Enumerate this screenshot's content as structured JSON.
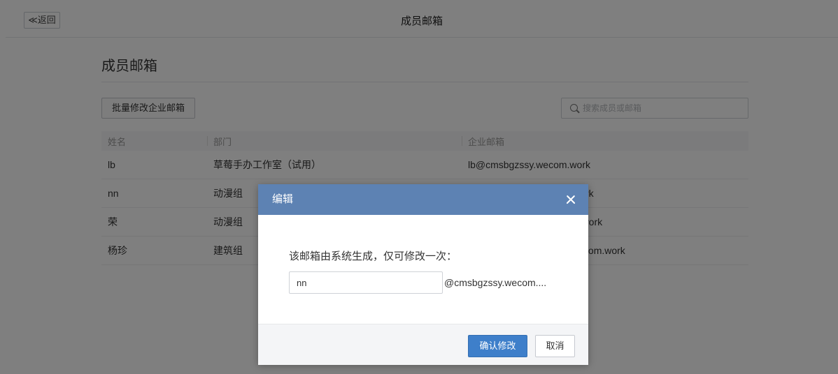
{
  "topbar": {
    "back_label": "≪返回",
    "title": "成员邮箱"
  },
  "content": {
    "title": "成员邮箱",
    "batch_button": "批量修改企业邮箱",
    "search_placeholder": "搜索成员或邮箱"
  },
  "table": {
    "headers": [
      "姓名",
      "部门",
      "企业邮箱"
    ],
    "rows": [
      {
        "name": "lb",
        "dept": "草莓手办工作室（试用）",
        "email": "lb@cmsbgzssy.wecom.work"
      },
      {
        "name": "nn",
        "dept": "动漫组",
        "email": "nn@cmsbgzssy.wecom.work"
      },
      {
        "name": "荣",
        "dept": "动漫组",
        "email": "rong@cmsbgzssy.wecom.work"
      },
      {
        "name": "杨珍",
        "dept": "建筑组",
        "email": "yangzhen@cmsbgzssy.wecom.work"
      }
    ]
  },
  "dialog": {
    "title": "编辑",
    "message": "该邮箱由系统生成，仅可修改一次：",
    "input_value": "nn",
    "domain_suffix": "@cmsbgzssy.wecom....",
    "confirm_label": "确认修改",
    "cancel_label": "取消"
  },
  "colors": {
    "header_blue": "#5d82b3",
    "primary_button": "#3e7fca"
  }
}
